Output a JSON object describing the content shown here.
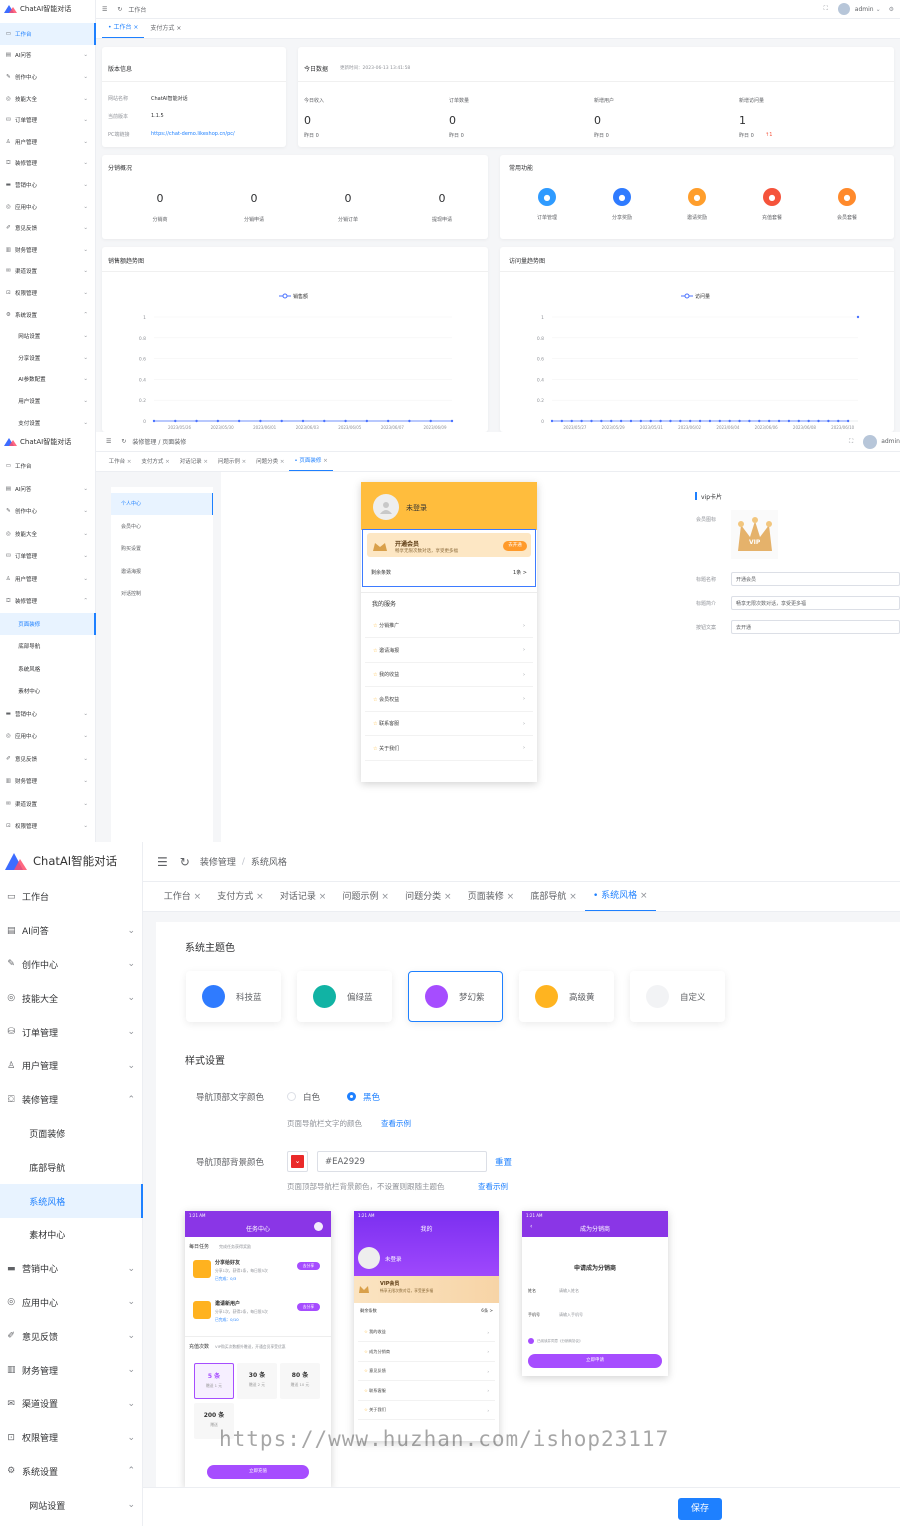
{
  "app": {
    "name": "ChatAI智能对话",
    "user": "admin"
  },
  "sidebar_items": [
    {
      "label": "工作台",
      "icon": "monitor-icon"
    },
    {
      "label": "AI问答",
      "icon": "message-icon"
    },
    {
      "label": "创作中心",
      "icon": "pen-icon"
    },
    {
      "label": "技能大全",
      "icon": "compass-icon"
    },
    {
      "label": "订单管理",
      "icon": "database-icon"
    },
    {
      "label": "用户管理",
      "icon": "user-icon"
    },
    {
      "label": "装修管理",
      "icon": "gift-icon"
    },
    {
      "label": "营销中心",
      "icon": "shop-icon"
    },
    {
      "label": "应用中心",
      "icon": "compass-icon"
    },
    {
      "label": "意见反馈",
      "icon": "edit-icon"
    },
    {
      "label": "财务管理",
      "icon": "bar-chart-icon"
    },
    {
      "label": "渠道设置",
      "icon": "mail-icon"
    },
    {
      "label": "权限管理",
      "icon": "lock-icon"
    },
    {
      "label": "系统设置",
      "icon": "gear-icon"
    },
    {
      "label": "网站设置",
      "icon": ""
    },
    {
      "label": "分享设置",
      "icon": ""
    },
    {
      "label": "AI参数配置",
      "icon": ""
    },
    {
      "label": "用户设置",
      "icon": ""
    },
    {
      "label": "支付设置",
      "icon": ""
    }
  ],
  "decor_sub": [
    "页面装修",
    "底部导航",
    "系统风格",
    "素材中心"
  ],
  "p1": {
    "breadcrumb": "工作台",
    "tabs": [
      "工作台",
      "支付方式"
    ],
    "version": {
      "title": "版本信息",
      "rows": [
        [
          "网站名称",
          "ChatAI智能对话"
        ],
        [
          "当前版本",
          "1.1.5"
        ],
        [
          "PC端链接",
          "https://chat-demo.likeshop.cn/pc/"
        ]
      ]
    },
    "today": {
      "title": "今日数据",
      "updated": "更新时间：2023-06-13 13:41:58",
      "stats": [
        {
          "label": "今日收入",
          "value": "0",
          "prev": "昨日 0"
        },
        {
          "label": "订单数量",
          "value": "0",
          "prev": "昨日 0"
        },
        {
          "label": "新增用户",
          "value": "0",
          "prev": "昨日 0"
        },
        {
          "label": "新增访问量",
          "value": "1",
          "prev": "昨日 0",
          "trend": "↑1"
        }
      ]
    },
    "dist": {
      "title": "分销概况",
      "stats": [
        {
          "value": "0",
          "label": "分销商"
        },
        {
          "value": "0",
          "label": "分销申请"
        },
        {
          "value": "0",
          "label": "分销订单"
        },
        {
          "value": "0",
          "label": "提现申请"
        }
      ]
    },
    "quick": {
      "title": "常用功能",
      "items": [
        {
          "label": "订单管理",
          "color": "#2f9bff"
        },
        {
          "label": "分享奖励",
          "color": "#2f7bff"
        },
        {
          "label": "邀请奖励",
          "color": "#ff9e2c"
        },
        {
          "label": "充值套餐",
          "color": "#f5533b"
        },
        {
          "label": "会员套餐",
          "color": "#ff8a2c"
        }
      ]
    }
  },
  "chart_data": [
    {
      "type": "line",
      "title": "销售额趋势图",
      "series": [
        {
          "name": "销售额",
          "values": [
            0,
            0,
            0,
            0,
            0,
            0,
            0,
            0,
            0,
            0,
            0,
            0,
            0,
            0,
            0
          ]
        }
      ],
      "x": [
        "2023/05/26",
        "2023/05/30",
        "2023/06/01",
        "2023/06/03",
        "2023/06/05",
        "2023/06/07",
        "2023/06/09"
      ],
      "yticks": [
        "0",
        "0.2",
        "0.4",
        "0.6",
        "0.8",
        "1"
      ],
      "ylim": [
        0,
        1
      ],
      "color": "#4a72ff"
    },
    {
      "type": "line",
      "title": "访问量趋势图",
      "series": [
        {
          "name": "访问量",
          "values": [
            0,
            0,
            0,
            0,
            0,
            0,
            0,
            0,
            0,
            0,
            0,
            0,
            0,
            0,
            0,
            0,
            0,
            0,
            0,
            0,
            0,
            0,
            0,
            0,
            0,
            0,
            0,
            0,
            0,
            0,
            0,
            1
          ]
        }
      ],
      "x": [
        "2023/05/27",
        "2023/05/29",
        "2023/05/31",
        "2023/06/02",
        "2023/06/04",
        "2023/06/06",
        "2023/06/08",
        "2023/06/10"
      ],
      "yticks": [
        "0",
        "0.2",
        "0.4",
        "0.6",
        "0.8",
        "1"
      ],
      "ylim": [
        0,
        1
      ],
      "color": "#4a72ff"
    }
  ],
  "p2": {
    "breadcrumb": "装修管理 / 页面装修",
    "tabs": [
      "工作台",
      "支付方式",
      "对话记录",
      "问题示例",
      "问题分类",
      "页面装修"
    ],
    "menu": [
      "个人中心",
      "会员中心",
      "购买设置",
      "邀请海报",
      "对话控制"
    ],
    "phone": {
      "login": "未登录",
      "member_title": "开通会员",
      "member_desc": "畅享无限次数对话，享受更多福",
      "member_btn": "去开通",
      "remaining": "剩余条数",
      "remaining_val": "1条 >",
      "services_title": "我的服务",
      "services": [
        "分销推广",
        "邀请海报",
        "我的收益",
        "会员权益",
        "联系客服",
        "关于我们"
      ]
    },
    "form": {
      "title": "vip卡片",
      "rows": [
        [
          "会员图标",
          ""
        ],
        [
          "标题名称",
          "开通会员"
        ],
        [
          "标题简介",
          "畅享无限次数对话，享受更多福"
        ],
        [
          "按钮文案",
          "去开通"
        ]
      ],
      "vip_text": "VIP"
    }
  },
  "p3": {
    "breadcrumb_a": "装修管理",
    "breadcrumb_b": "系统风格",
    "tabs": [
      "工作台",
      "支付方式",
      "对话记录",
      "问题示例",
      "问题分类",
      "页面装修",
      "底部导航",
      "系统风格"
    ],
    "theme_title": "系统主题色",
    "themes": [
      {
        "label": "科技蓝",
        "color": "#2f7bff"
      },
      {
        "label": "偏绿蓝",
        "color": "#11b3a4"
      },
      {
        "label": "梦幻紫",
        "color": "#a64dff"
      },
      {
        "label": "高级黄",
        "color": "#ffb420"
      },
      {
        "label": "自定义",
        "color": "#f2f3f5"
      }
    ],
    "style_title": "样式设置",
    "nav_text_label": "导航顶部文字颜色",
    "opt_white": "白色",
    "opt_black": "黑色",
    "nav_text_hint": "页面导航栏文字的颜色",
    "see_example": "查看示例",
    "nav_bg_label": "导航顶部背景颜色",
    "nav_bg_value": "#EA2929",
    "reset": "重置",
    "nav_bg_hint": "页面顶部导航栏背景颜色，不设置则跟随主题色",
    "save": "保存",
    "m1": {
      "time": "1:21 AM",
      "title": "任务中心",
      "daily": "每日任务",
      "daily_sub": "完成任务获得奖励",
      "t1": "分享给好友",
      "t1_sub": "分享1次，获得1条，每日限5次",
      "t1_done": "已完成：0/3",
      "btn": "去分享",
      "t2": "邀请新用户",
      "t2_sub": "分享1次，获得2条，每日限5次",
      "t2_done": "已完成：0/10",
      "btn2": "去分享",
      "recharge": "充值次数",
      "recharge_sub": "VIP购买次数额外赠送，开通会员享受优惠",
      "packs": [
        [
          "5 条",
          "赠送 1 元"
        ],
        [
          "30 条",
          "赠送 2 元"
        ],
        [
          "80 条",
          "赠送 10 元"
        ],
        [
          "200 条",
          "赠送"
        ]
      ],
      "buy": "立即充值"
    },
    "m2": {
      "time": "1:21 AM",
      "title": "我的",
      "login": "未登录",
      "vip": "VIP会员",
      "vip_desc": "畅享无限次数对话，享受更多福",
      "remain": "剩余条数",
      "remain_val": "6条 >",
      "items": [
        "我的收益",
        "成为分销商",
        "意见反馈",
        "联系客服",
        "关于我们"
      ]
    },
    "m3": {
      "time": "1:21 AM",
      "title": "成为分销商",
      "heading": "申请成为分销商",
      "f1": "姓名",
      "f1p": "请输入姓名",
      "f2": "手机号",
      "f2p": "请输入手机号",
      "agree": "已阅读并同意《分销商协议》",
      "btn": "立即申请"
    }
  },
  "watermark": "https://www.huzhan.com/ishop23117"
}
